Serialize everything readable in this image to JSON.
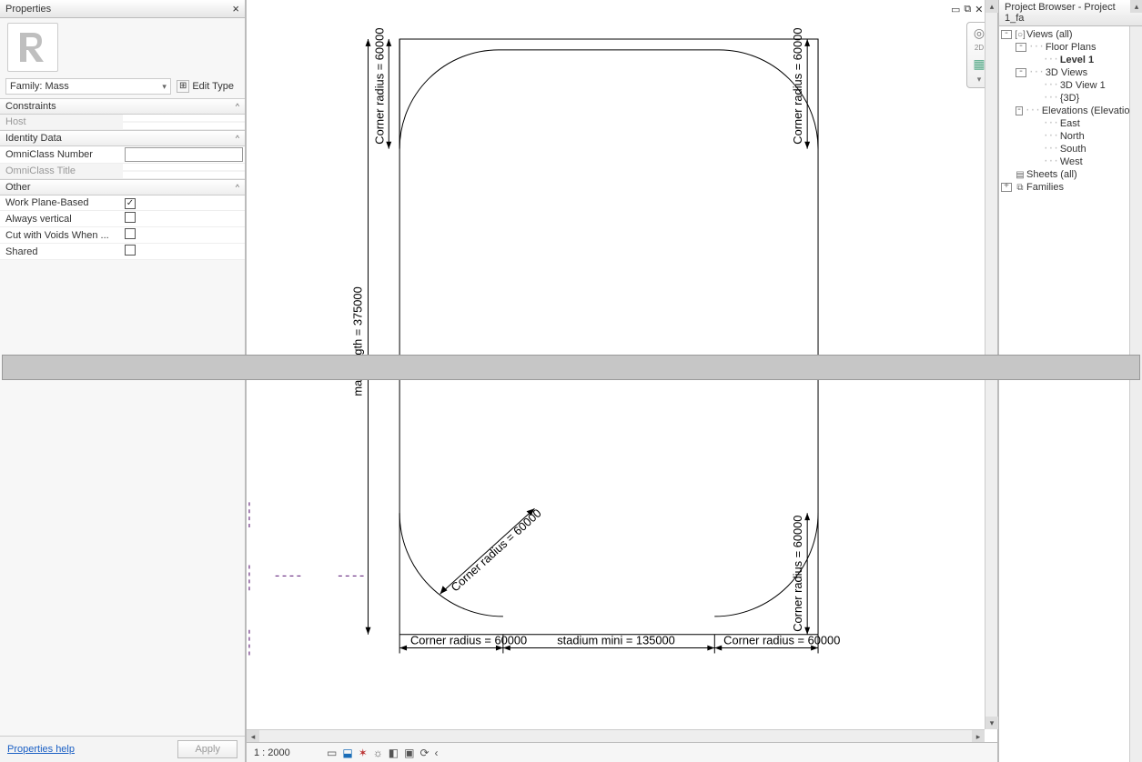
{
  "properties": {
    "title": "Properties",
    "family_label": "Family: Mass",
    "edit_type": "Edit Type",
    "groups": [
      {
        "name": "Constraints",
        "rows": [
          {
            "k": "Host",
            "type": "disabled"
          }
        ]
      },
      {
        "name": "Identity Data",
        "rows": [
          {
            "k": "OmniClass Number",
            "type": "text",
            "v": ""
          },
          {
            "k": "OmniClass Title",
            "type": "disabled"
          }
        ]
      },
      {
        "name": "Other",
        "rows": [
          {
            "k": "Work Plane-Based",
            "type": "check",
            "v": true
          },
          {
            "k": "Always vertical",
            "type": "check",
            "v": false
          },
          {
            "k": "Cut with Voids When ...",
            "type": "check",
            "v": false
          },
          {
            "k": "Shared",
            "type": "check",
            "v": false
          }
        ]
      }
    ],
    "help_link": "Properties help",
    "apply": "Apply"
  },
  "viewbar": {
    "scale": "1 : 2000"
  },
  "dimensions": {
    "corner_radius": "Corner radius = 60000",
    "max_length": "max length = 375000",
    "stadium_mini": "stadium mini = 135000"
  },
  "browser": {
    "title": "Project Browser - Project 1_fa",
    "tree": [
      {
        "depth": 0,
        "tw": "-",
        "ico": "views",
        "label": "Views (all)"
      },
      {
        "depth": 1,
        "tw": "-",
        "label": "Floor Plans"
      },
      {
        "depth": 2,
        "tw": "",
        "label": "Level 1",
        "selected": true
      },
      {
        "depth": 1,
        "tw": "-",
        "label": "3D Views"
      },
      {
        "depth": 2,
        "tw": "",
        "label": "3D View 1"
      },
      {
        "depth": 2,
        "tw": "",
        "label": "{3D}"
      },
      {
        "depth": 1,
        "tw": "-",
        "label": "Elevations (Elevation"
      },
      {
        "depth": 2,
        "tw": "",
        "label": "East"
      },
      {
        "depth": 2,
        "tw": "",
        "label": "North"
      },
      {
        "depth": 2,
        "tw": "",
        "label": "South"
      },
      {
        "depth": 2,
        "tw": "",
        "label": "West"
      },
      {
        "depth": 0,
        "tw": "",
        "ico": "sheets",
        "label": "Sheets (all)"
      },
      {
        "depth": 0,
        "tw": "+",
        "ico": "fam",
        "label": "Families"
      }
    ]
  }
}
